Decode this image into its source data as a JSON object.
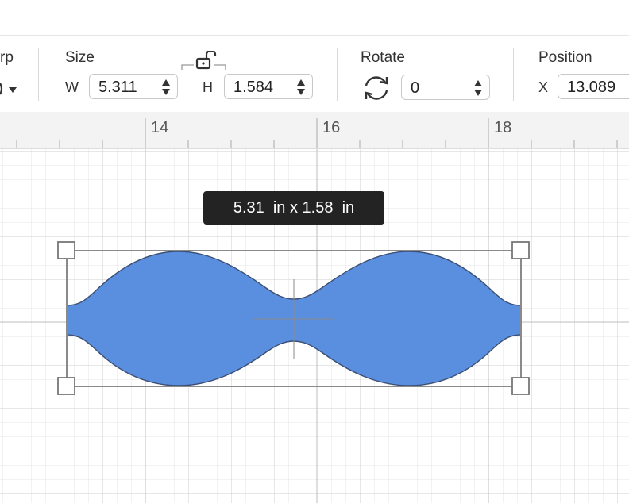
{
  "toolbar": {
    "warp_partial_label": "rp",
    "size": {
      "label": "Size",
      "w_label": "W",
      "w_value": "5.311",
      "h_label": "H",
      "h_value": "1.584",
      "lock_icon": "unlock-icon"
    },
    "rotate": {
      "label": "Rotate",
      "value": "0",
      "icon": "rotate-icon"
    },
    "position": {
      "label": "Position",
      "x_label": "X",
      "x_value": "13.089"
    }
  },
  "ruler": {
    "labels": [
      "14",
      "16",
      "18"
    ]
  },
  "canvas": {
    "dimension_tooltip": "5.31  in x 1.58  in",
    "shape_color": "#5a8fe0"
  }
}
